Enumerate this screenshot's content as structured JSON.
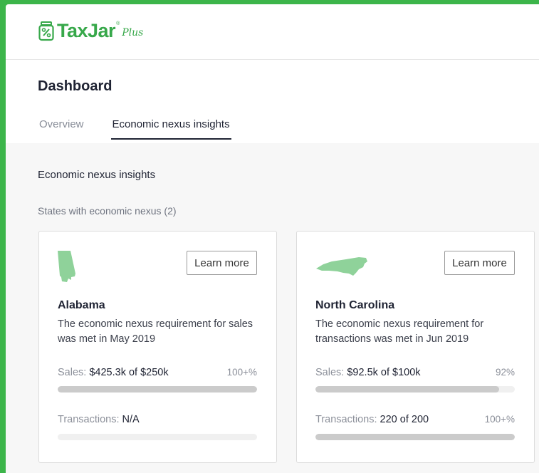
{
  "brand": {
    "name": "TaxJar",
    "registered": "®",
    "tier": "Plus",
    "color": "#37a84a"
  },
  "page": {
    "title": "Dashboard"
  },
  "tabs": [
    {
      "label": "Overview",
      "active": false
    },
    {
      "label": "Economic nexus insights",
      "active": true
    }
  ],
  "section": {
    "title": "Economic nexus insights",
    "subtitle": "States with economic nexus (2)"
  },
  "cards": [
    {
      "state": "Alabama",
      "state_icon": "alabama-shape-icon",
      "button": "Learn more",
      "description": "The economic nexus requirement for sales was met in May 2019",
      "sales": {
        "label": "Sales:",
        "value": "$425.3k of $250k",
        "percent": "100+%",
        "progress": 1.0
      },
      "transactions": {
        "label": "Transactions:",
        "value": "N/A",
        "percent": "",
        "progress": 0
      }
    },
    {
      "state": "North Carolina",
      "state_icon": "north-carolina-shape-icon",
      "button": "Learn more",
      "description": "The economic nexus requirement for transactions was met in Jun 2019",
      "sales": {
        "label": "Sales:",
        "value": "$92.5k of $100k",
        "percent": "92%",
        "progress": 0.92
      },
      "transactions": {
        "label": "Transactions:",
        "value": "220 of 200",
        "percent": "100+%",
        "progress": 1.0
      }
    }
  ],
  "colors": {
    "background": "#3cb54a",
    "state_fill": "#8fd29a",
    "progress_fill": "#cbcbcb",
    "progress_track": "#f0f0f0"
  }
}
